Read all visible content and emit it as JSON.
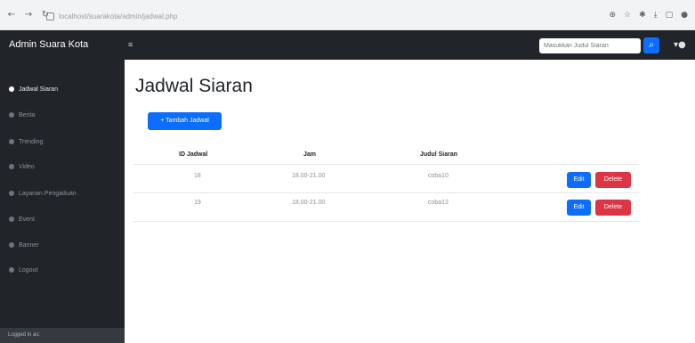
{
  "browser": {
    "url": "localhost/suarakota/admin/jadwal.php",
    "back_icon": "←",
    "forward_icon": "→",
    "reload_icon": "↻"
  },
  "navbar": {
    "brand": "Admin Suara Kota",
    "toggle_icon": "≡",
    "search_placeholder": "Masukkan Judul Siaran",
    "search_icon": "🔍",
    "user_icon": "👤"
  },
  "sidebar": {
    "items": [
      {
        "label": "Jadwal Siaran",
        "active": true
      },
      {
        "label": "Berita"
      },
      {
        "label": "Trending"
      },
      {
        "label": "Video"
      },
      {
        "label": "Layanan Pengaduan"
      },
      {
        "label": "Event"
      },
      {
        "label": "Banner"
      },
      {
        "label": "Logout"
      }
    ],
    "footer": "Logged in as:"
  },
  "main": {
    "title": "Jadwal Siaran",
    "add_button": "+ Tambah Jadwal",
    "table": {
      "headers": [
        "ID Jadwal",
        "Jam",
        "Judul Siaran"
      ],
      "rows": [
        {
          "id": "18",
          "jam": "18.00-21.00",
          "judul": "coba10",
          "edit": "Edit",
          "delete": "Delete"
        },
        {
          "id": "19",
          "jam": "18.00-21.00",
          "judul": "coba12",
          "edit": "Edit",
          "delete": "Delete"
        }
      ]
    }
  }
}
